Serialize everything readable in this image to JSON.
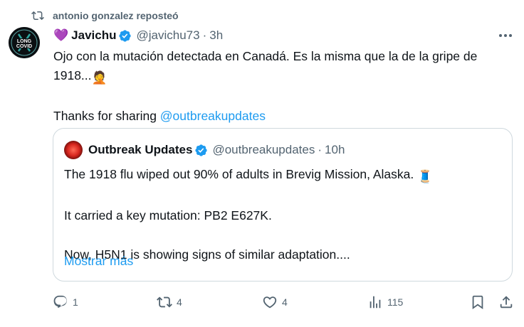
{
  "repost": {
    "text": "antonio gonzalez reposteó",
    "icon": "repost-icon"
  },
  "post": {
    "avatar_label": "LONG COVID",
    "name_prefix": "💜",
    "name": "Javichu",
    "handle": "@javichu73",
    "separator": "·",
    "time": "3h",
    "text_line1": "Ojo con la mutación detectada en Canadá. Es la misma que la de la gripe de",
    "text_line2": "1918...",
    "emoji2": "🤦",
    "thanks_text": "Thanks for sharing ",
    "mention": "@outbreakupdates"
  },
  "quote": {
    "name": "Outbreak Updates",
    "handle": "@outbreakupdates",
    "separator": "·",
    "time": "10h",
    "line1": "The 1918 flu wiped out 90% of adults in Brevig Mission, Alaska.",
    "line1_emoji": "🧵",
    "line2": "It carried a key mutation: PB2 E627K.",
    "line3": "Now, H5N1 is showing signs of similar adaptation....",
    "show_more": "Mostrar más"
  },
  "actions": {
    "replies": "1",
    "reposts": "4",
    "likes": "4",
    "views": "115"
  },
  "colors": {
    "accent": "#1d9bf0",
    "muted": "#536471",
    "text": "#0f1419",
    "border": "#cfd9de",
    "verified": "#1d9bf0"
  }
}
